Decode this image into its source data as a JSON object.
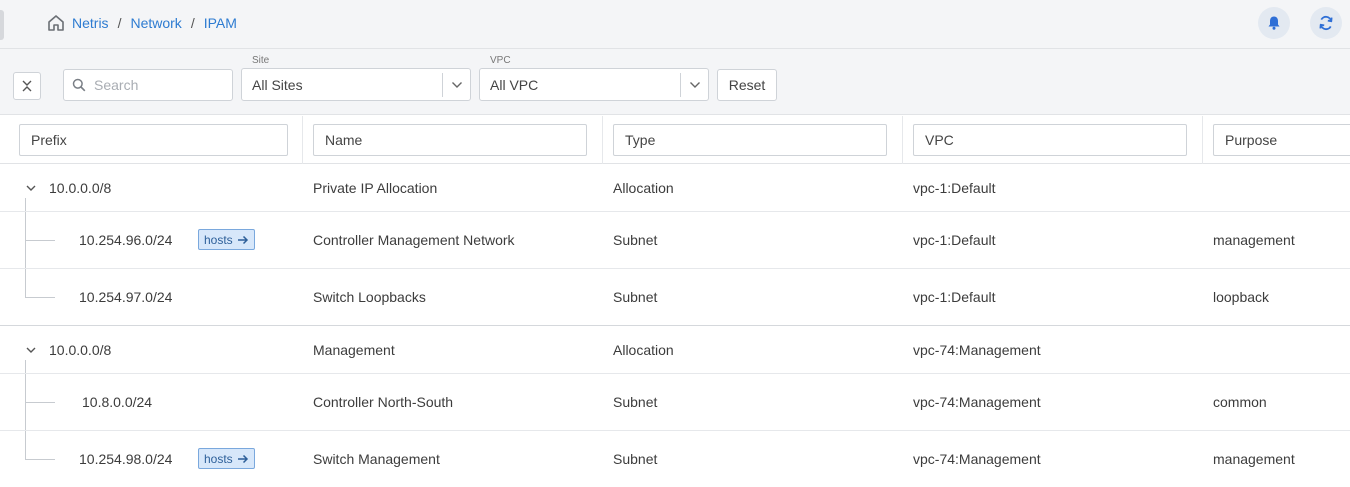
{
  "breadcrumb": {
    "items": [
      "Netris",
      "Network",
      "IPAM"
    ],
    "separator": "/"
  },
  "filters": {
    "search_placeholder": "Search",
    "site": {
      "label": "Site",
      "value": "All Sites"
    },
    "vpc": {
      "label": "VPC",
      "value": "All VPC"
    },
    "reset_label": "Reset"
  },
  "columns": [
    "Prefix",
    "Name",
    "Type",
    "VPC",
    "Purpose"
  ],
  "rows": [
    {
      "prefix": "10.0.0.0/8",
      "name": "Private IP Allocation",
      "type": "Allocation",
      "vpc": "vpc-1:Default",
      "purpose": ""
    },
    {
      "prefix": "10.254.96.0/24",
      "hosts": "hosts",
      "name": "Controller Management Network",
      "type": "Subnet",
      "vpc": "vpc-1:Default",
      "purpose": "management"
    },
    {
      "prefix": "10.254.97.0/24",
      "name": "Switch Loopbacks",
      "type": "Subnet",
      "vpc": "vpc-1:Default",
      "purpose": "loopback"
    },
    {
      "prefix": "10.0.0.0/8",
      "name": "Management",
      "type": "Allocation",
      "vpc": "vpc-74:Management",
      "purpose": ""
    },
    {
      "prefix": "10.8.0.0/24",
      "name": "Controller North-South",
      "type": "Subnet",
      "vpc": "vpc-74:Management",
      "purpose": "common"
    },
    {
      "prefix": "10.254.98.0/24",
      "hosts": "hosts",
      "name": "Switch Management",
      "type": "Subnet",
      "vpc": "vpc-74:Management",
      "purpose": "management"
    }
  ],
  "colors": {
    "link": "#2d7bd1",
    "accent": "#2f6fd6",
    "badge_bg": "#d7e7fa",
    "header_bg": "#f4f5f7"
  },
  "icons": {
    "home": "home-icon",
    "bell": "bell-icon",
    "refresh": "refresh-icon",
    "search": "search-icon",
    "collapse": "collapse-icon",
    "chevron": "chevron-down-icon",
    "arrow": "arrow-right-icon"
  }
}
